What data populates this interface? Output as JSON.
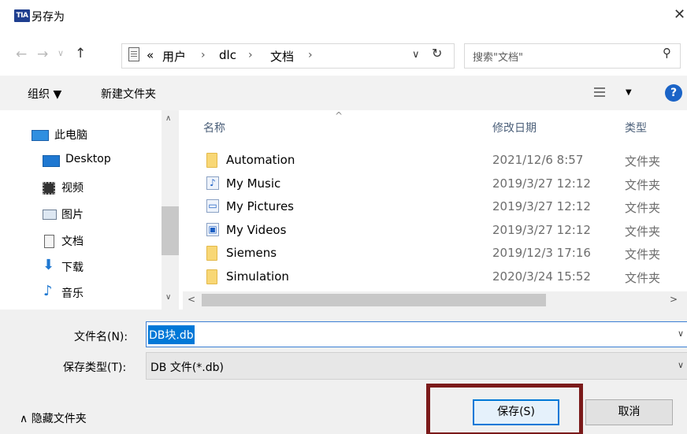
{
  "window": {
    "title": "另存为",
    "app_icon_text": "TIA",
    "close_glyph": "✕"
  },
  "address": {
    "back_glyph": "←",
    "forward_glyph": "→",
    "recent_glyph": "∨",
    "up_glyph": "↑",
    "overflow": "«",
    "crumbs": [
      "用户",
      "dlc",
      "文档"
    ],
    "sep": "›",
    "dropdown_glyph": "∨",
    "refresh_glyph": "↻"
  },
  "search": {
    "placeholder": "搜索\"文档\"",
    "icon_glyph": "⚲"
  },
  "toolbar": {
    "organize": "组织 ▼",
    "new_folder": "新建文件夹",
    "view_dropdown": "▼",
    "help": "?"
  },
  "sidebar": {
    "items": [
      {
        "label": "此电脑",
        "icon": "computer-icon"
      },
      {
        "label": "Desktop",
        "icon": "desktop-icon"
      },
      {
        "label": "视频",
        "icon": "video-icon"
      },
      {
        "label": "图片",
        "icon": "pictures-icon"
      },
      {
        "label": "文档",
        "icon": "documents-icon"
      },
      {
        "label": "下载",
        "icon": "download-icon"
      },
      {
        "label": "音乐",
        "icon": "music-icon"
      }
    ],
    "scroll_up": "∧",
    "scroll_down": "∨"
  },
  "file_list": {
    "columns": {
      "name": "名称",
      "date": "修改日期",
      "type": "类型"
    },
    "sort_arrow": "^",
    "rows": [
      {
        "name": "Automation",
        "date": "2021/12/6 8:57",
        "type": "文件夹",
        "icon": "folder-icon"
      },
      {
        "name": "My Music",
        "date": "2019/3/27 12:12",
        "type": "文件夹",
        "icon": "music-folder-icon"
      },
      {
        "name": "My Pictures",
        "date": "2019/3/27 12:12",
        "type": "文件夹",
        "icon": "pictures-folder-icon"
      },
      {
        "name": "My Videos",
        "date": "2019/3/27 12:12",
        "type": "文件夹",
        "icon": "videos-folder-icon"
      },
      {
        "name": "Siemens",
        "date": "2019/12/3 17:16",
        "type": "文件夹",
        "icon": "folder-icon"
      },
      {
        "name": "Simulation",
        "date": "2020/3/24 15:52",
        "type": "文件夹",
        "icon": "folder-icon"
      }
    ],
    "scroll_left": "<",
    "scroll_right": ">"
  },
  "form": {
    "filename_label": "文件名(N):",
    "filename_value": "DB块.db",
    "filetype_label": "保存类型(T):",
    "filetype_value": "DB 文件(*.db)",
    "dropdown_glyph": "∨"
  },
  "footer": {
    "hide_folders": "∧  隐藏文件夹",
    "save": "保存(S)",
    "cancel": "取消"
  },
  "colors": {
    "accent": "#0078d7",
    "highlight_frame": "#7b1a1a",
    "help_blue": "#1b64c7"
  }
}
